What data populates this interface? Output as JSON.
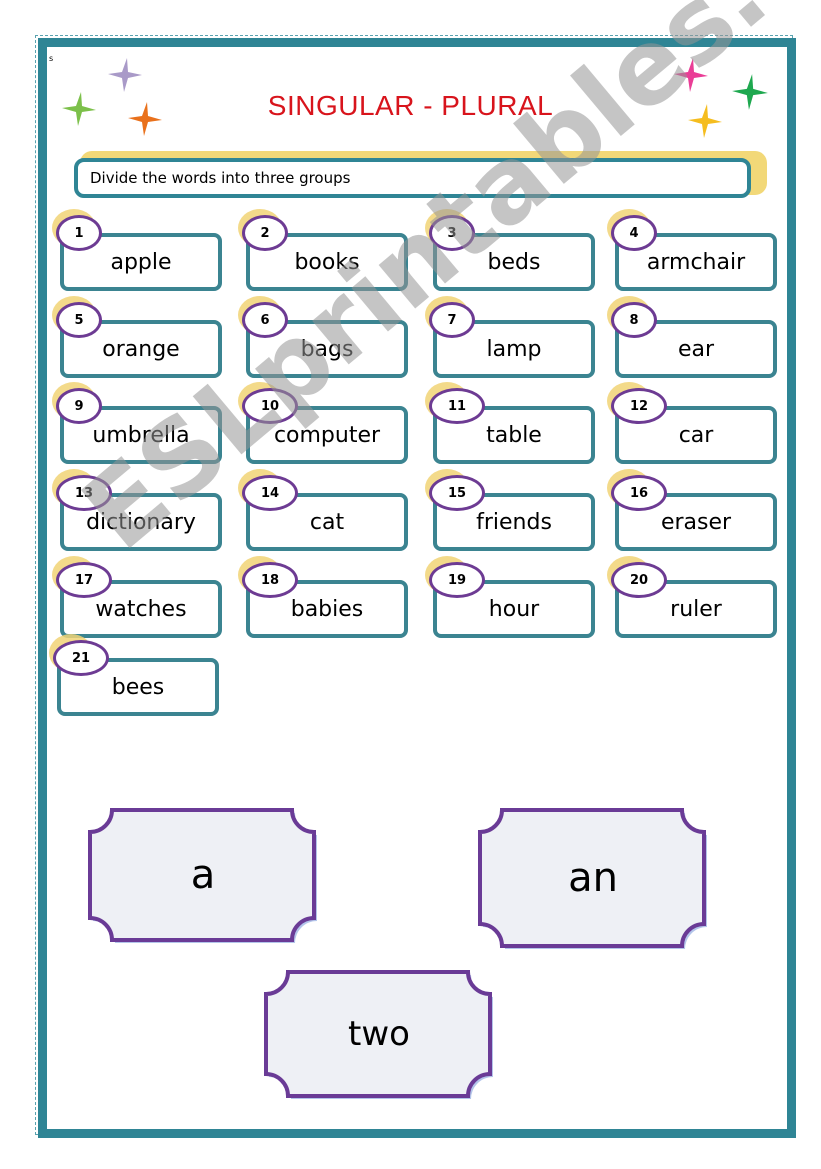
{
  "worksheet": {
    "corner_mark": "s",
    "title": "SINGULAR - PLURAL",
    "instruction": "Divide the words into three groups",
    "colors": {
      "title": "#d8141c",
      "frame": "#2f8595",
      "card_border": "#3b8491",
      "number_circle": "#6d3b93",
      "label_border": "#6a3b96"
    },
    "stars": [
      {
        "name": "star-purple",
        "color": "#a99ac8"
      },
      {
        "name": "star-green",
        "color": "#7cc04a"
      },
      {
        "name": "star-orange",
        "color": "#e9711c"
      },
      {
        "name": "star-pink",
        "color": "#ea3d96"
      },
      {
        "name": "star-darkgreen",
        "color": "#1ea84f"
      },
      {
        "name": "star-yellow",
        "color": "#f5bd1f"
      }
    ],
    "words": [
      {
        "num": "1",
        "word": "apple"
      },
      {
        "num": "2",
        "word": "books"
      },
      {
        "num": "3",
        "word": "beds"
      },
      {
        "num": "4",
        "word": "armchair"
      },
      {
        "num": "5",
        "word": "orange"
      },
      {
        "num": "6",
        "word": "bags"
      },
      {
        "num": "7",
        "word": "lamp"
      },
      {
        "num": "8",
        "word": "ear"
      },
      {
        "num": "9",
        "word": "umbrella"
      },
      {
        "num": "10",
        "word": "computer"
      },
      {
        "num": "11",
        "word": "table"
      },
      {
        "num": "12",
        "word": "car"
      },
      {
        "num": "13",
        "word": "dictionary"
      },
      {
        "num": "14",
        "word": "cat"
      },
      {
        "num": "15",
        "word": "friends"
      },
      {
        "num": "16",
        "word": "eraser"
      },
      {
        "num": "17",
        "word": "watches"
      },
      {
        "num": "18",
        "word": "babies"
      },
      {
        "num": "19",
        "word": "hour"
      },
      {
        "num": "20",
        "word": "ruler"
      },
      {
        "num": "21",
        "word": "bees"
      }
    ],
    "groups": [
      {
        "label": "a"
      },
      {
        "label": "an"
      },
      {
        "label": "two"
      }
    ],
    "watermark": "ESLprintables.com"
  }
}
